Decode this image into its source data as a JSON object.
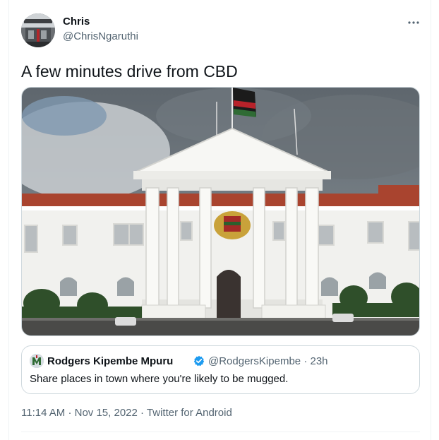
{
  "author": {
    "name": "Chris",
    "handle": "@ChrisNgaruthi"
  },
  "more_icon": "more-horizontal-icon",
  "tweet": {
    "text": "A few minutes drive from CBD"
  },
  "quoted_tweet": {
    "name": "Rodgers Kipembe Mpuru",
    "verified_icon": "verified-badge-icon",
    "verified_color": "#1d9bf0",
    "handle": "@RodgersKipembe",
    "separator": "·",
    "time": "23h",
    "text": "Share places in town where you're likely to be mugged."
  },
  "meta": {
    "time": "11:14 AM",
    "separator1": "·",
    "date": "Nov 15, 2022",
    "separator2": "·",
    "source": "Twitter for Android"
  },
  "colors": {
    "text": "#0f1419",
    "secondary": "#536471",
    "border": "#cfd9de"
  }
}
